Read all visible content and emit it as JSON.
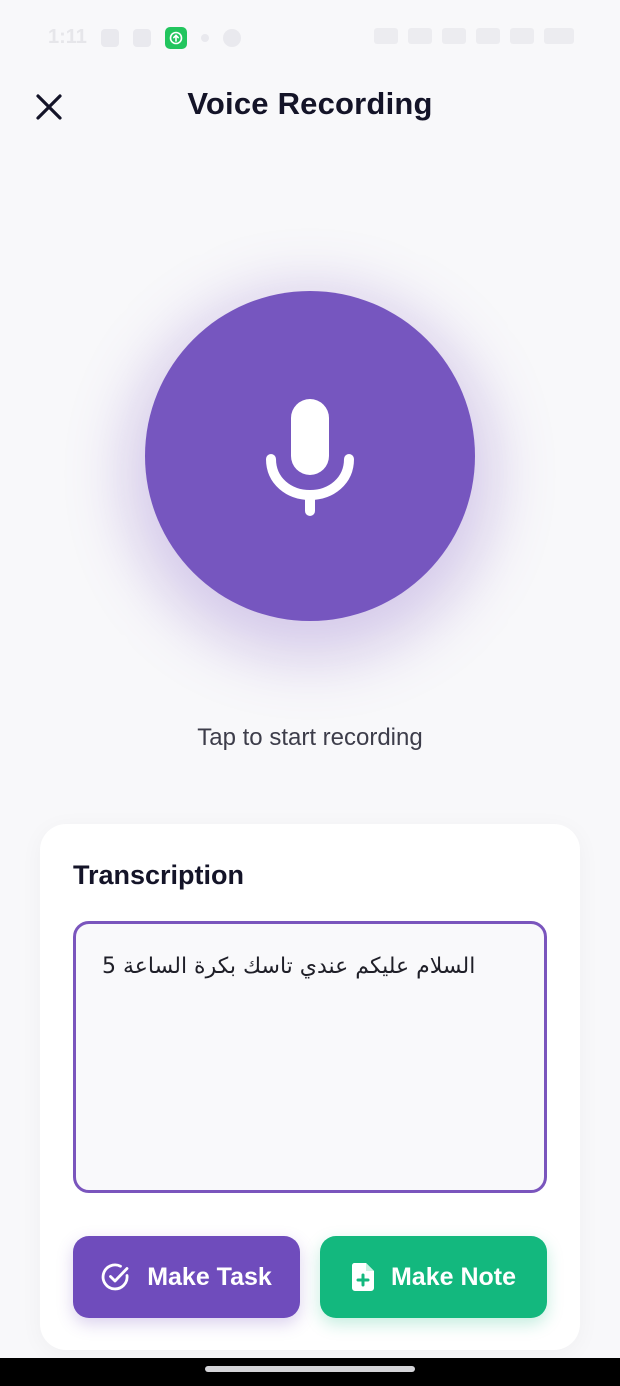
{
  "status_bar": {
    "time": "1:11"
  },
  "header": {
    "title": "Voice Recording",
    "close_icon": "close-icon"
  },
  "recorder": {
    "mic_icon": "microphone-icon",
    "hint": "Tap to start recording"
  },
  "transcription": {
    "title": "Transcription",
    "text": "السلام عليكم عندي تاسك بكرة الساعة 5"
  },
  "actions": {
    "make_task": "Make Task",
    "make_note": "Make Note",
    "task_icon": "check-circle-icon",
    "note_icon": "file-add-icon"
  },
  "colors": {
    "primary": "#7656bf",
    "accent_green": "#13b87e",
    "background": "#f8f8fa"
  }
}
